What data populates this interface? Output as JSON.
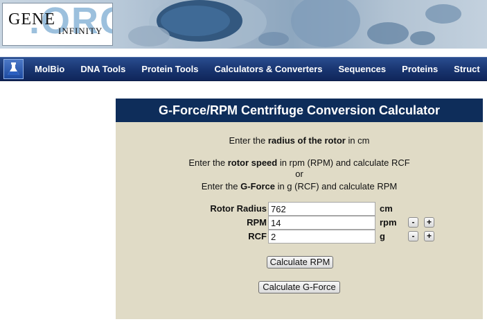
{
  "header": {
    "logo_main": "GENE",
    "logo_sub": "INFINITY",
    "logo_ghost": ".ORG"
  },
  "nav": {
    "items": [
      "MolBio",
      "DNA Tools",
      "Protein Tools",
      "Calculators & Converters",
      "Sequences",
      "Proteins",
      "Struct"
    ]
  },
  "calculator": {
    "title": "G-Force/RPM Centrifuge Conversion Calculator",
    "instruction_radius": {
      "pre": "Enter the ",
      "bold": "radius of the rotor",
      "post": " in cm"
    },
    "instruction_speed": {
      "pre": "Enter the ",
      "bold": "rotor speed",
      "post": " in rpm (RPM) and calculate RCF"
    },
    "instruction_or": "or",
    "instruction_gforce": {
      "pre": "Enter the ",
      "bold": "G-Force",
      "post": " in g (RCF) and calculate RPM"
    },
    "fields": {
      "radius": {
        "label": "Rotor Radius",
        "value": "762",
        "unit": "cm"
      },
      "rpm": {
        "label": "RPM",
        "value": "14",
        "unit": "rpm"
      },
      "rcf": {
        "label": "RCF",
        "value": "2",
        "unit": "g"
      }
    },
    "stepper_minus": "-",
    "stepper_plus": "+",
    "calc_rpm_label": "Calculate RPM",
    "calc_gforce_label": "Calculate G-Force"
  }
}
